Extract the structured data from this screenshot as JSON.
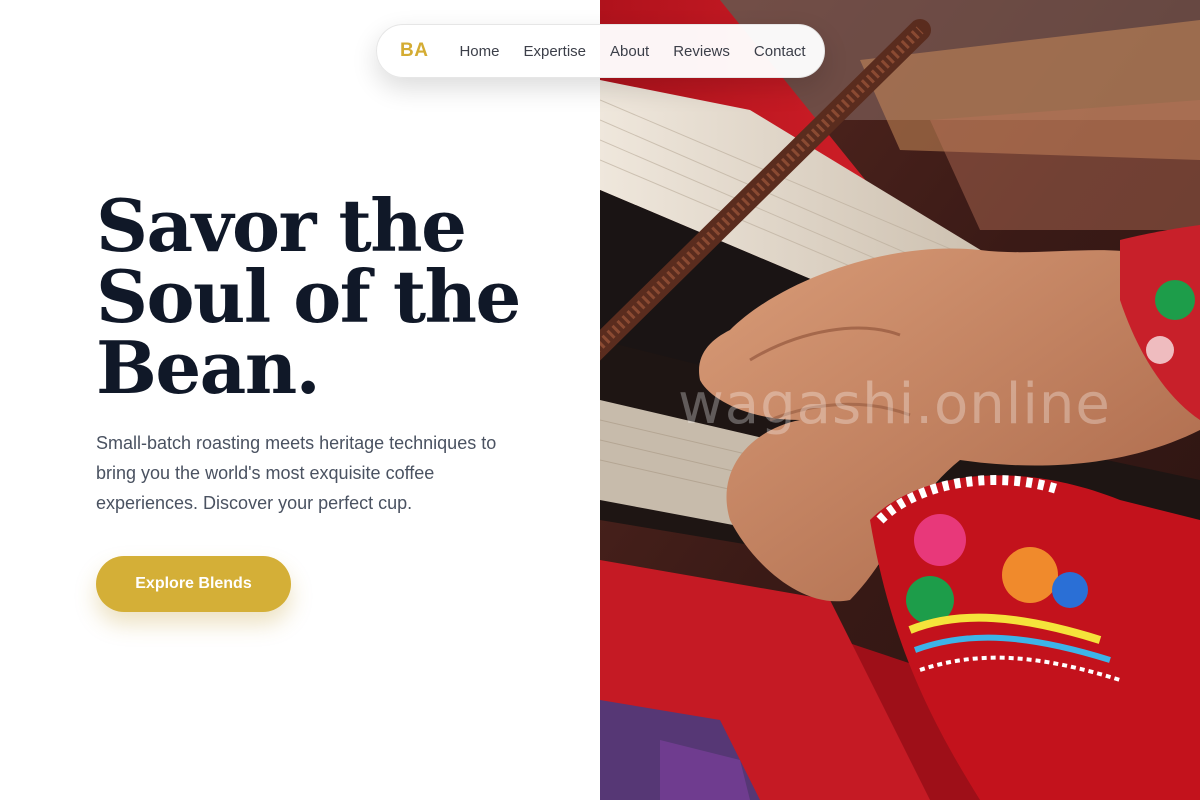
{
  "nav": {
    "logo": "BA",
    "links": [
      "Home",
      "Expertise",
      "About",
      "Reviews",
      "Contact"
    ]
  },
  "hero": {
    "title_lines": [
      "Savor the",
      "Soul of the",
      "Bean."
    ],
    "subtitle": "Small-batch roasting meets heritage techniques to bring you the world's most exquisite coffee experiences. Discover your perfect cup.",
    "cta_label": "Explore Blends"
  },
  "image": {
    "watermark": "wagashi.online"
  },
  "colors": {
    "accent": "#d4af37",
    "logo": "#d4ac33",
    "heading": "#101828",
    "body": "#4a5261"
  }
}
